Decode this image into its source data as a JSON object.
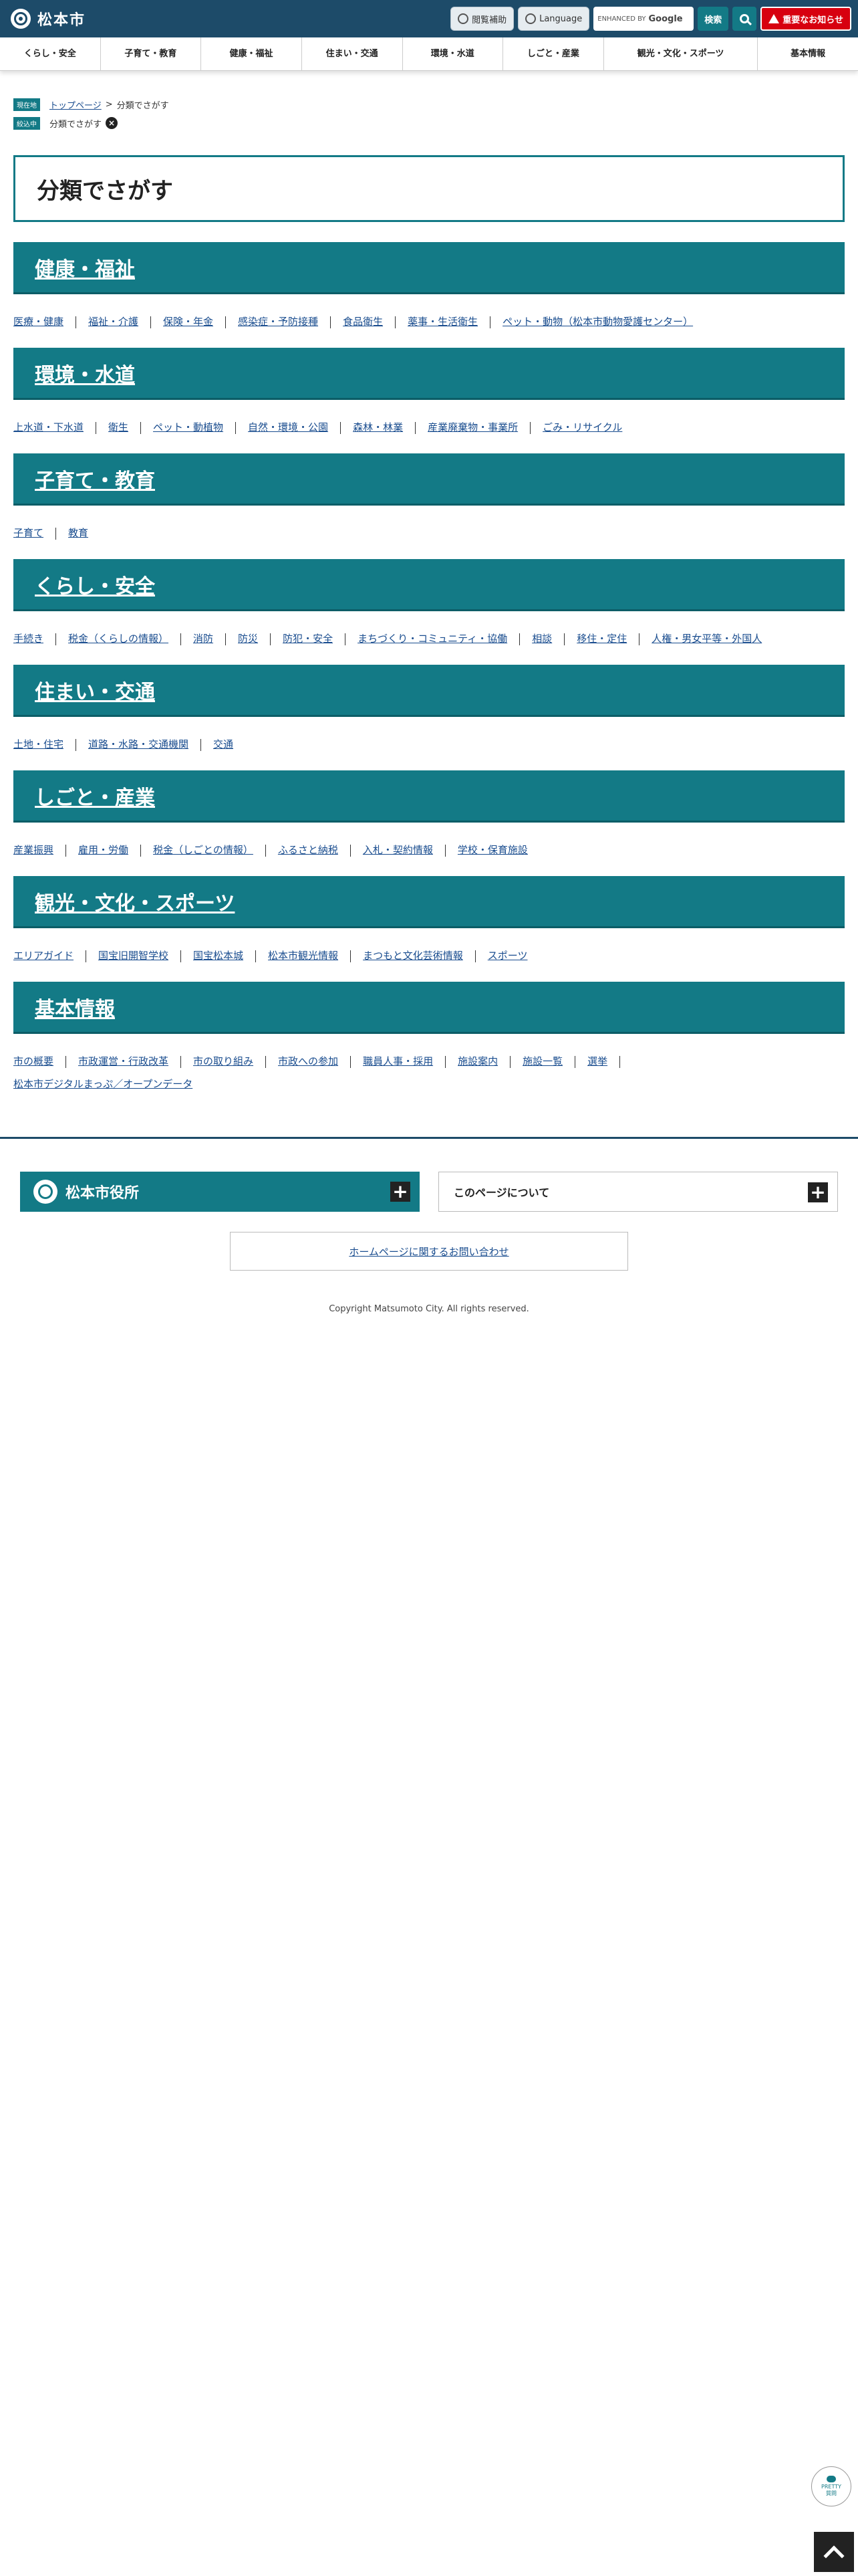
{
  "header": {
    "site_name": "松本市",
    "tools": {
      "assist_label": "閲覧補助",
      "language_label": "Language",
      "search_placeholder": "ENHANCED BY",
      "search_brand": "Google",
      "search_button": "検索",
      "alert_label": "重要なお知らせ"
    },
    "icons": {
      "assist": "accessibility-icon",
      "language": "globe-icon",
      "search": "search-icon",
      "alert": "warning-icon"
    }
  },
  "nav": {
    "items": [
      "くらし・安全",
      "子育て・教育",
      "健康・福祉",
      "住まい・交通",
      "環境・水道",
      "しごと・産業",
      "観光・文化・スポーツ",
      "基本情報"
    ]
  },
  "breadcrumb": {
    "current_tag": "現在地",
    "home": "トップページ",
    "separator": ">",
    "current": "分類でさがす",
    "filter_tag": "絞込中",
    "filter_value": "分類でさがす"
  },
  "page_title": "分類でさがす",
  "categories": [
    {
      "title": "健康・福祉",
      "links": [
        "医療・健康",
        "福祉・介護",
        "保険・年金",
        "感染症・予防接種",
        "食品衛生",
        "薬事・生活衛生",
        "ペット・動物（松本市動物愛護センター）"
      ]
    },
    {
      "title": "環境・水道",
      "links": [
        "上水道・下水道",
        "衛生",
        "ペット・動植物",
        "自然・環境・公園",
        "森林・林業",
        "産業廃棄物・事業所",
        "ごみ・リサイクル"
      ]
    },
    {
      "title": "子育て・教育",
      "links": [
        "子育て",
        "教育"
      ]
    },
    {
      "title": "くらし・安全",
      "links": [
        "手続き",
        "税金（くらしの情報）",
        "消防",
        "防災",
        "防犯・安全",
        "まちづくり・コミュニティ・協働",
        "相談",
        "移住・定住",
        "人権・男女平等・外国人"
      ]
    },
    {
      "title": "住まい・交通",
      "links": [
        "土地・住宅",
        "道路・水路・交通機関",
        "交通"
      ]
    },
    {
      "title": "しごと・産業",
      "links": [
        "産業振興",
        "雇用・労働",
        "税金（しごとの情報）",
        "ふるさと納税",
        "入札・契約情報",
        "学校・保育施設"
      ]
    },
    {
      "title": "観光・文化・スポーツ",
      "links": [
        "エリアガイド",
        "国宝旧開智学校",
        "国宝松本城",
        "松本市観光情報",
        "まつもと文化芸術情報",
        "スポーツ"
      ]
    },
    {
      "title": "基本情報",
      "links": [
        "市の概要",
        "市政運営・行政改革",
        "市の取り組み",
        "市政への参加",
        "職員人事・採用",
        "施設案内",
        "施設一覧",
        "選挙",
        "松本市デジタルまっぷ／オープンデータ"
      ]
    }
  ],
  "footer": {
    "city_office": "松本市役所",
    "about_page": "このページについて",
    "inquiry": "ホームページに関するお問い合わせ",
    "copyright": "Copyright Matsumoto City. All rights reserved.",
    "chat_label": "PRETTY",
    "chat_sub": "質問"
  }
}
